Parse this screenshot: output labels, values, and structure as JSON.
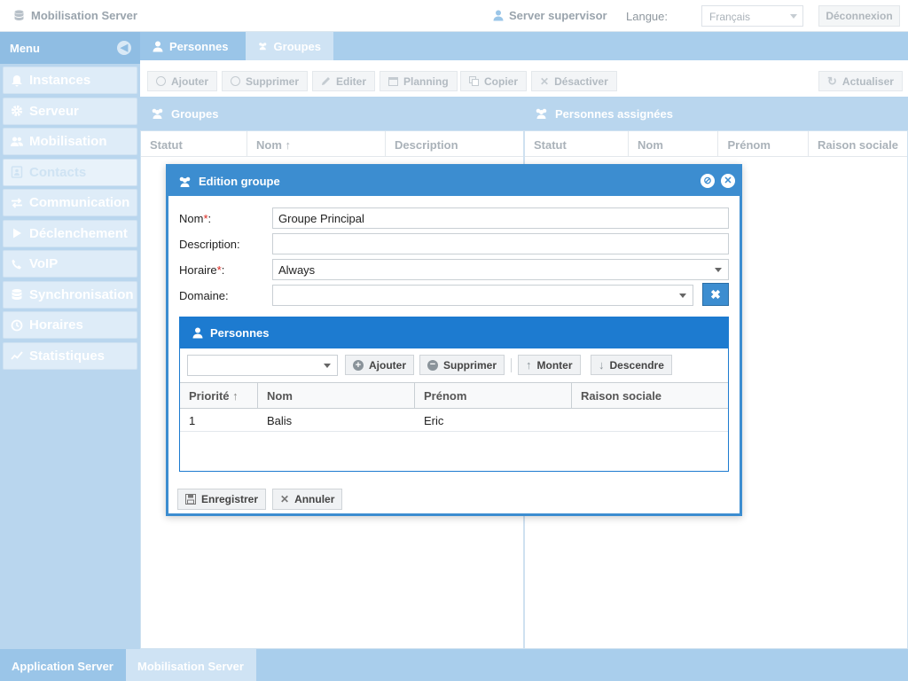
{
  "header": {
    "app_title": "Mobilisation Server",
    "user": "Server supervisor",
    "language_label": "Langue:",
    "language_value": "Français",
    "logout": "Déconnexion"
  },
  "sidebar": {
    "title": "Menu",
    "items": [
      {
        "label": "Instances",
        "icon": "bell-icon"
      },
      {
        "label": "Serveur",
        "icon": "gear-icon"
      },
      {
        "label": "Mobilisation",
        "icon": "users-icon"
      },
      {
        "label": "Contacts",
        "icon": "contact-card-icon",
        "active": true
      },
      {
        "label": "Communication",
        "icon": "exchange-icon"
      },
      {
        "label": "Déclenchement",
        "icon": "play-icon"
      },
      {
        "label": "VoIP",
        "icon": "phone-icon"
      },
      {
        "label": "Synchronisation",
        "icon": "database-icon"
      },
      {
        "label": "Horaires",
        "icon": "clock-icon"
      },
      {
        "label": "Statistiques",
        "icon": "chart-line-icon"
      }
    ]
  },
  "tabs": [
    {
      "label": "Personnes",
      "icon": "user-icon"
    },
    {
      "label": "Groupes",
      "icon": "group-icon",
      "active": true
    }
  ],
  "toolbar": {
    "add": "Ajouter",
    "delete": "Supprimer",
    "edit": "Editer",
    "planning": "Planning",
    "copy": "Copier",
    "deactivate": "Désactiver",
    "refresh": "Actualiser"
  },
  "left_panel": {
    "title": "Groupes",
    "columns": [
      "Statut",
      "Nom",
      "Description"
    ]
  },
  "right_panel": {
    "title": "Personnes assignées",
    "columns": [
      "Statut",
      "Nom",
      "Prénom",
      "Raison sociale"
    ]
  },
  "dialog": {
    "title": "Edition groupe",
    "fields": {
      "name_label": "Nom",
      "name_value": "Groupe Principal",
      "description_label": "Description:",
      "description_value": "",
      "schedule_label": "Horaire",
      "schedule_value": "Always",
      "domain_label": "Domaine:",
      "domain_value": ""
    },
    "persons": {
      "title": "Personnes",
      "add": "Ajouter",
      "delete": "Supprimer",
      "up": "Monter",
      "down": "Descendre",
      "columns": [
        "Priorité",
        "Nom",
        "Prénom",
        "Raison sociale"
      ],
      "rows": [
        {
          "priority": "1",
          "name": "Balis",
          "firstname": "Eric",
          "company": ""
        }
      ]
    },
    "save": "Enregistrer",
    "cancel": "Annuler"
  },
  "bottom_tabs": [
    {
      "label": "Application Server"
    },
    {
      "label": "Mobilisation Server",
      "active": true
    }
  ],
  "colors": {
    "accent": "#3c8dd0",
    "subpanel": "#1d7bd0",
    "required": "#d9251d"
  }
}
